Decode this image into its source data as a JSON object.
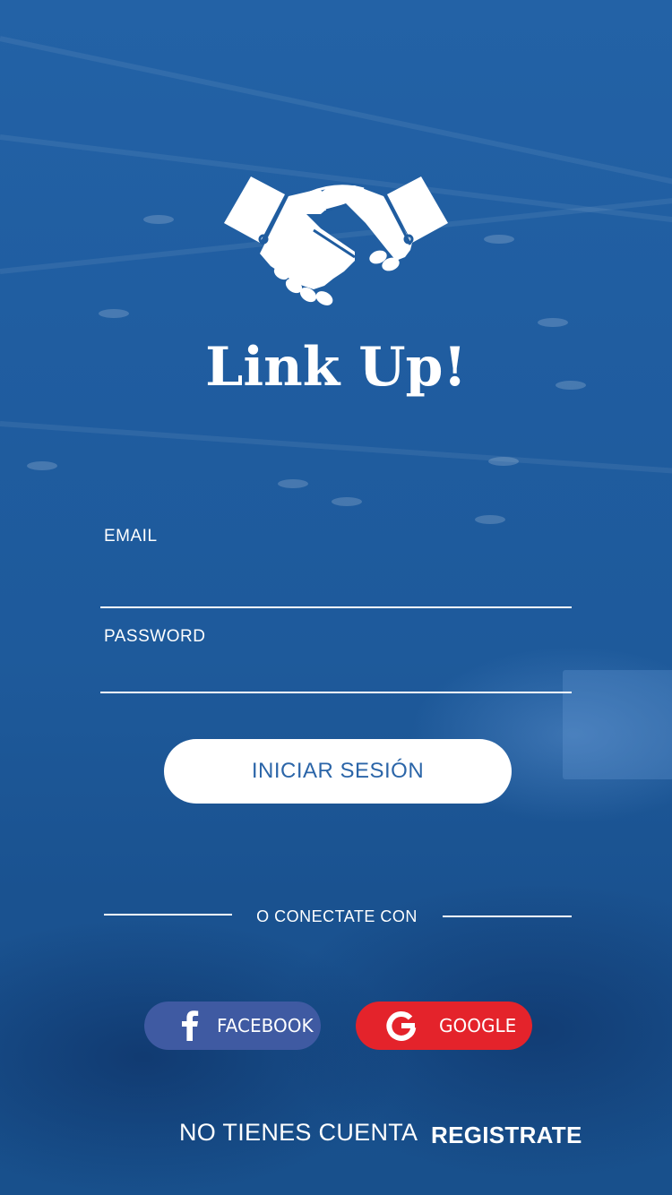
{
  "app": {
    "title": "Link Up!",
    "logo_icon": "handshake-icon"
  },
  "form": {
    "email": {
      "label": "EMAIL",
      "value": ""
    },
    "password": {
      "label": "PASSWORD",
      "value": ""
    },
    "login_label": "INICIAR SESIÓN"
  },
  "social": {
    "divider_text": "O CONECTATE CON",
    "facebook": {
      "label": "FACEBOOK",
      "icon": "facebook-icon",
      "color": "#3f5aa2"
    },
    "google": {
      "label": "GOOGLE",
      "icon": "google-icon",
      "color": "#e4232b"
    }
  },
  "footer": {
    "no_account_text": "NO TIENES CUENTA",
    "register_label": "REGISTRATE"
  },
  "colors": {
    "background": "#1d5a9b",
    "login_button_text": "#2b65a8",
    "text": "#ffffff"
  }
}
